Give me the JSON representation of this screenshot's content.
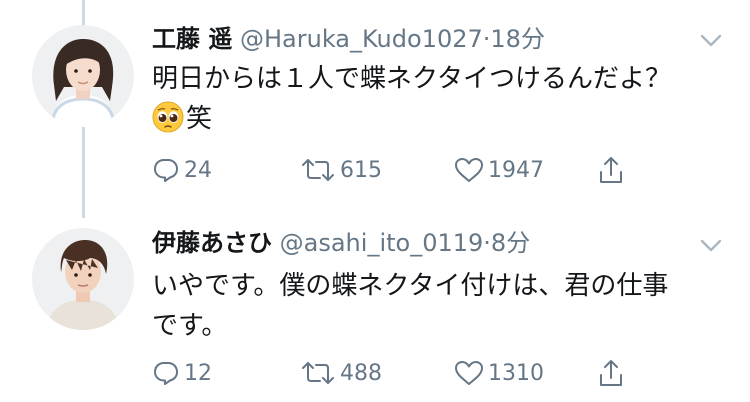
{
  "tweets": [
    {
      "display_name": "工藤 遥",
      "handle": "@Haruka_Kudo1027",
      "separator": "·",
      "time": "18分",
      "text_line1": "明日からは１人で蝶ネクタイつけるんだよ？",
      "text_line2": "笑",
      "emoji": "pleading-face",
      "replies": "24",
      "retweets": "615",
      "likes": "1947"
    },
    {
      "display_name": "伊藤あさひ",
      "handle": "@asahi_ito_0119",
      "separator": "·",
      "time": "8分",
      "text_line1": "いやです。僕の蝶ネクタイ付けは、君の仕事",
      "text_line2": "です。",
      "replies": "12",
      "retweets": "488",
      "likes": "1310"
    }
  ],
  "colors": {
    "text": "#14171a",
    "secondary": "#657786",
    "thread_line": "#cfd9de"
  }
}
